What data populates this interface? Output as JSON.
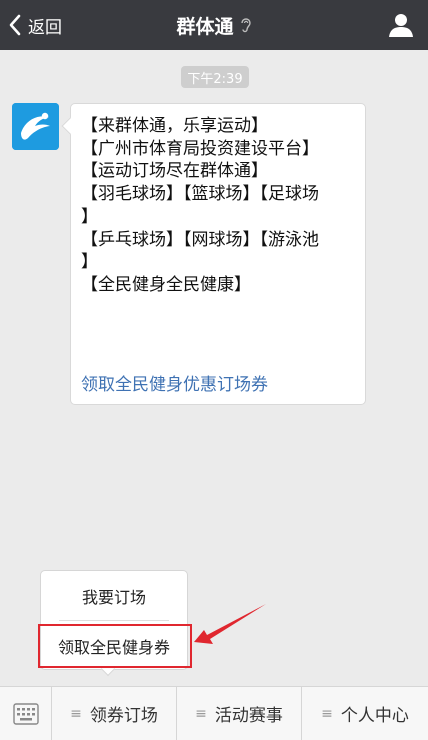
{
  "navbar": {
    "back_label": "返回",
    "title": "群体通"
  },
  "chat": {
    "timestamp": "下午2:39",
    "message": {
      "lines": [
        "【来群体通，乐享运动】",
        "【广州市体育局投资建设平台】",
        "【运动订场尽在群体通】",
        "【羽毛球场】【篮球场】【足球场",
        "】",
        "【乒乓球场】【网球场】【游泳池",
        "】",
        "【全民健身全民健康】"
      ],
      "link_text": "领取全民健身优惠订场券"
    }
  },
  "popup_menu": {
    "items": [
      {
        "label": "我要订场"
      },
      {
        "label": "领取全民健身券"
      }
    ]
  },
  "bottom_menu": {
    "tabs": [
      {
        "label": "领券订场"
      },
      {
        "label": "活动赛事"
      },
      {
        "label": "个人中心"
      }
    ]
  },
  "colors": {
    "navbar": "#393a3f",
    "link": "#3f72b3",
    "highlight": "#e0272f",
    "avatar": "#1e9be0"
  }
}
